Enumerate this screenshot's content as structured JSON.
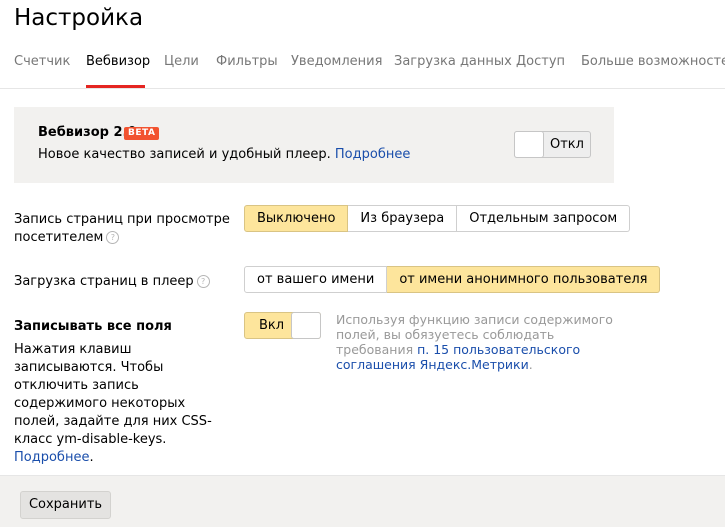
{
  "page": {
    "title": "Настройка"
  },
  "tabs": [
    {
      "label": "Счетчик"
    },
    {
      "label": "Вебвизор"
    },
    {
      "label": "Цели"
    },
    {
      "label": "Фильтры"
    },
    {
      "label": "Уведомления"
    },
    {
      "label": "Загрузка данных"
    },
    {
      "label": "Доступ"
    },
    {
      "label": "Больше возможностей"
    }
  ],
  "active_tab": "Вебвизор",
  "promo": {
    "title": "Вебвизор 2.0",
    "badge": "BETA",
    "description": "Новое качество записей и удобный плеер.",
    "more_link": "Подробнее",
    "toggle_label": "Откл"
  },
  "recording": {
    "label_line1": "Запись страниц при просмотре",
    "label_line2": "посетителем",
    "help_icon": "?",
    "options": [
      "Выключено",
      "Из браузера",
      "Отдельным запросом"
    ],
    "selected": "Выключено"
  },
  "loading": {
    "label": "Загрузка страниц в плеер",
    "help_icon": "?",
    "options": [
      "от вашего имени",
      "от имени анонимного пользователя"
    ],
    "selected": "от имени анонимного пользователя"
  },
  "fields": {
    "title": "Записывать все поля",
    "description": "Нажатия клавиш записываются. Чтобы отключить запись содержимого некоторых полей, задайте для них CSS-класс ym-disable-keys.",
    "more_link": "Подробнее",
    "toggle_label": "Вкл",
    "note_text": "Используя функцию записи содержимого полей, вы обязуетесь соблюдать требования",
    "note_link": "п. 15 пользовательского соглашения Яндекс.Метрики",
    "note_end": "."
  },
  "footer": {
    "save_label": "Сохранить"
  },
  "colors": {
    "accent_red": "#e52521",
    "selected_yellow": "#fde59c",
    "link_blue": "#1a4eab",
    "badge_orange": "#f25330"
  }
}
